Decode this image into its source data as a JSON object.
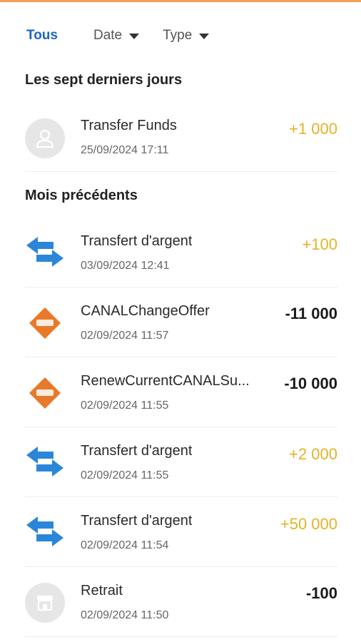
{
  "colors": {
    "accent": "#1a66c2",
    "positive_amount": "#e3b327",
    "negative_amount": "#1a1a1a",
    "transfer_icon": "#2b86d9",
    "money_icon": "#e8792a",
    "top_bar": "#f0a055"
  },
  "filters": {
    "all_label": "Tous",
    "date_label": "Date",
    "type_label": "Type"
  },
  "sections": {
    "last_seven_days": "Les sept derniers jours",
    "previous_months": "Mois précédents"
  },
  "transactions": [
    {
      "icon": "user-avatar-icon",
      "name": "Transfer Funds",
      "date": "25/09/2024 17:11",
      "amount": "+1 000",
      "sign": "positive"
    },
    {
      "icon": "transfer-arrows-icon",
      "name": "Transfert d'argent",
      "date": "03/09/2024 12:41",
      "amount": "+100",
      "sign": "positive"
    },
    {
      "icon": "money-logo-icon",
      "name": "CANALChangeOffer",
      "date": "02/09/2024 11:57",
      "amount": "-11 000",
      "sign": "negative"
    },
    {
      "icon": "money-logo-icon",
      "name": "RenewCurrentCANALSu...",
      "date": "02/09/2024 11:55",
      "amount": "-10 000",
      "sign": "negative"
    },
    {
      "icon": "transfer-arrows-icon",
      "name": "Transfert d'argent",
      "date": "02/09/2024 11:55",
      "amount": "+2 000",
      "sign": "positive"
    },
    {
      "icon": "transfer-arrows-icon",
      "name": "Transfert d'argent",
      "date": "02/09/2024 11:54",
      "amount": "+50 000",
      "sign": "positive"
    },
    {
      "icon": "store-icon",
      "name": "Retrait",
      "date": "02/09/2024 11:50",
      "amount": "-100",
      "sign": "negative"
    }
  ]
}
